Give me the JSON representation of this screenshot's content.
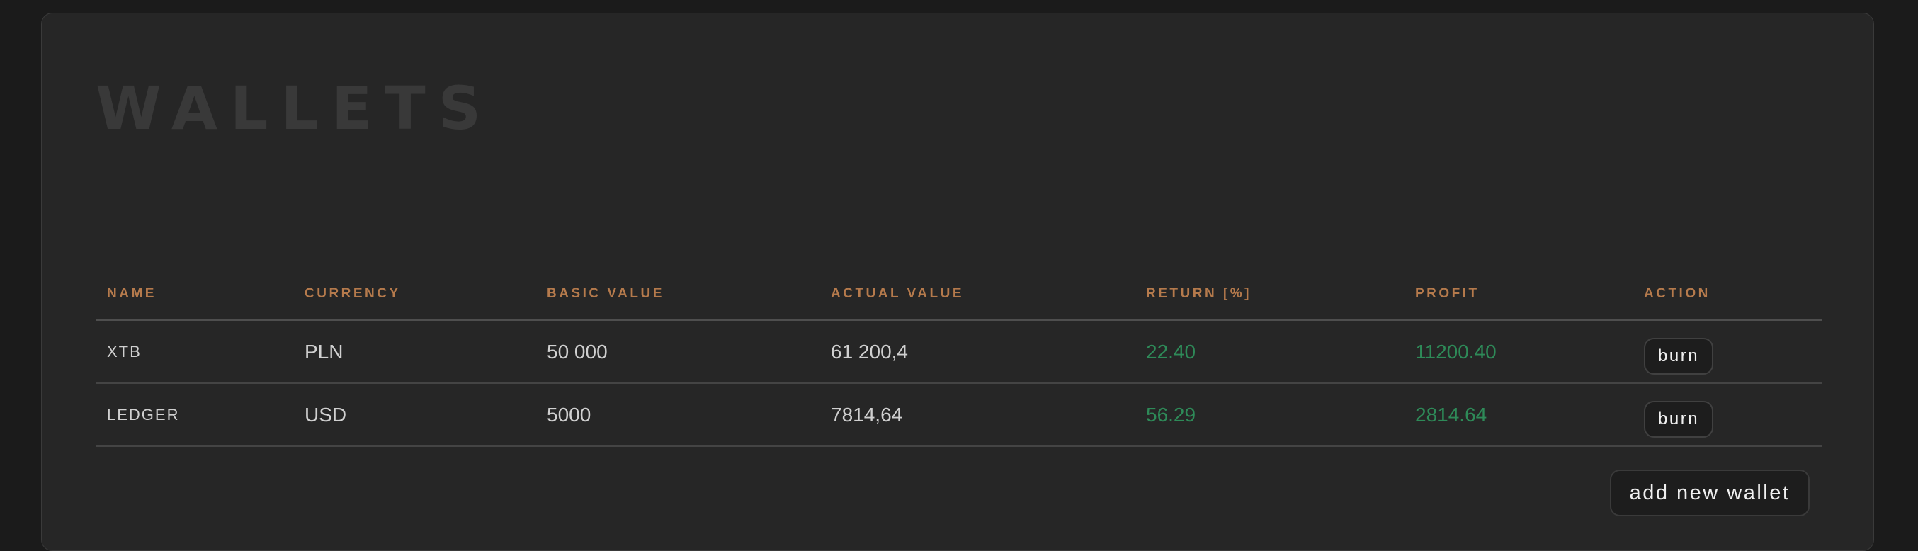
{
  "page": {
    "title": "WALLETS"
  },
  "table": {
    "columns": [
      "NAME",
      "CURRENCY",
      "BASIC VALUE",
      "ACTUAL VALUE",
      "RETURN [%]",
      "PROFIT",
      "ACTION"
    ],
    "rows": [
      {
        "name": "XTB",
        "currency": "PLN",
        "basic_value": "50 000",
        "actual_value": "61 200,4",
        "return_pct": "22.40",
        "profit": "11200.40",
        "action_label": "burn"
      },
      {
        "name": "LEDGER",
        "currency": "USD",
        "basic_value": "5000",
        "actual_value": "7814,64",
        "return_pct": "56.29",
        "profit": "2814.64",
        "action_label": "burn"
      }
    ]
  },
  "actions": {
    "add_wallet_label": "add new wallet"
  },
  "colors": {
    "page_background": "#1b1b1b",
    "panel_background": "#262626",
    "header_accent": "#b57a4c",
    "positive_value": "#2e8a58",
    "title_text": "#393939"
  }
}
